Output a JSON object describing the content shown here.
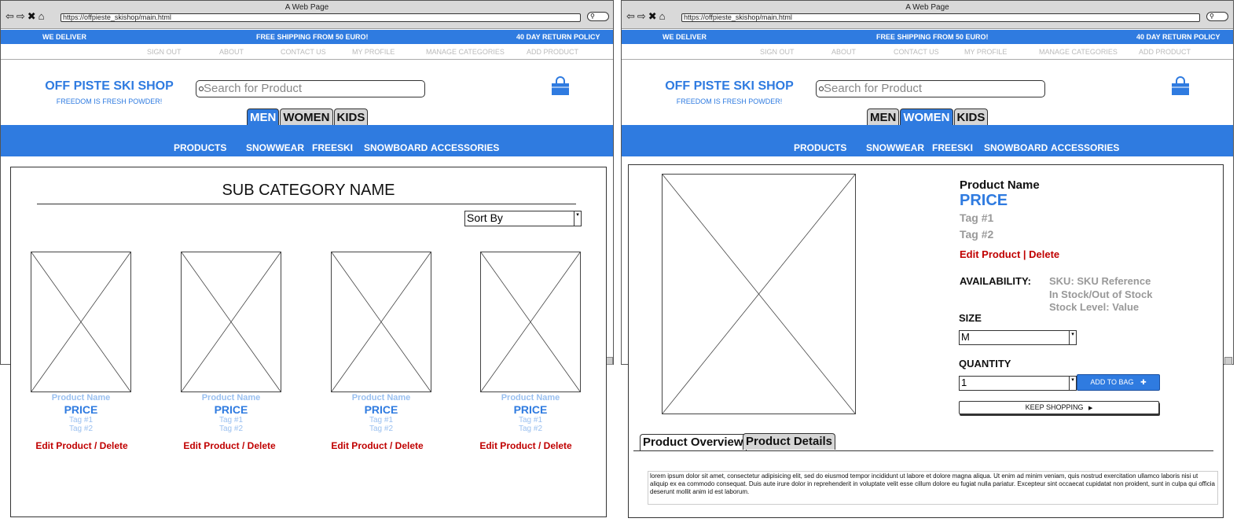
{
  "browser": {
    "title": "A Web Page",
    "url": "https://offpieste_skishop/main.html",
    "nav_glyphs": "⇦⇨✖⌂"
  },
  "promo": {
    "left": "WE DELIVER",
    "center": "FREE SHIPPING FROM 50 EURO!",
    "right": "40 DAY RETURN POLICY"
  },
  "admin_links": [
    "SIGN OUT",
    "ABOUT",
    "CONTACT US",
    "MY PROFILE",
    "MANAGE CATEGORIES",
    "ADD PRODUCT"
  ],
  "brand": {
    "name": "OFF PISTE SKI SHOP",
    "tagline": "FREEDOM IS FRESH POWDER!"
  },
  "search": {
    "placeholder": "Search for Product"
  },
  "gender_tabs": [
    "MEN",
    "WOMEN",
    "KIDS"
  ],
  "left_active_tab": "MEN",
  "right_active_tab": "WOMEN",
  "categories": [
    "PRODUCTS",
    "SNOWWEAR",
    "FREESKI",
    "SNOWBOARD",
    "ACCESSORIES"
  ],
  "category_page": {
    "heading": "SUB CATEGORY NAME",
    "sort_label": "Sort By",
    "products": [
      {
        "name": "Product Name",
        "price": "PRICE",
        "tag1": "Tag #1",
        "tag2": "Tag #2",
        "action": "Edit Product / Delete"
      },
      {
        "name": "Product Name",
        "price": "PRICE",
        "tag1": "Tag #1",
        "tag2": "Tag #2",
        "action": "Edit Product / Delete"
      },
      {
        "name": "Product Name",
        "price": "PRICE",
        "tag1": "Tag #1",
        "tag2": "Tag #2",
        "action": "Edit Product / Delete"
      },
      {
        "name": "Product Name",
        "price": "PRICE",
        "tag1": "Tag #1",
        "tag2": "Tag #2",
        "action": "Edit Product / Delete"
      }
    ]
  },
  "detail_page": {
    "name": "Product Name",
    "price": "PRICE",
    "tag1": "Tag #1",
    "tag2": "Tag #2",
    "action": "Edit Product | Delete",
    "availability_label": "AVAILABILITY:",
    "sku": "SKU: SKU Reference",
    "stock": "In Stock/Out of Stock",
    "stock_level": "Stock Level: Value",
    "size_label": "SIZE",
    "size_value": "M",
    "quantity_label": "QUANTITY",
    "quantity_value": "1",
    "add_to_bag": "ADD TO BAG",
    "add_icon": "✚",
    "keep_shopping": "KEEP SHOPPING",
    "keep_icon": "▶",
    "tabs": [
      "Product Overview",
      "Product Details"
    ],
    "description": "lorem ipsum dolor sit amet, consectetur adipisicing elit, sed do eiusmod tempor incididunt ut labore et dolore magna aliqua. Ut enim ad minim veniam, quis nostrud exercitation ullamco laboris nisi ut aliquip ex ea commodo consequat. Duis aute irure dolor in reprehenderit in voluptate velit esse cillum dolore eu fugiat nulla pariatur. Excepteur sint occaecat cupidatat non proident, sunt in culpa qui officia deserunt mollit anim id est laborum."
  },
  "colors": {
    "brand_blue": "#2f7be0",
    "edit_red": "#c00000",
    "muted_grey": "#999999"
  }
}
